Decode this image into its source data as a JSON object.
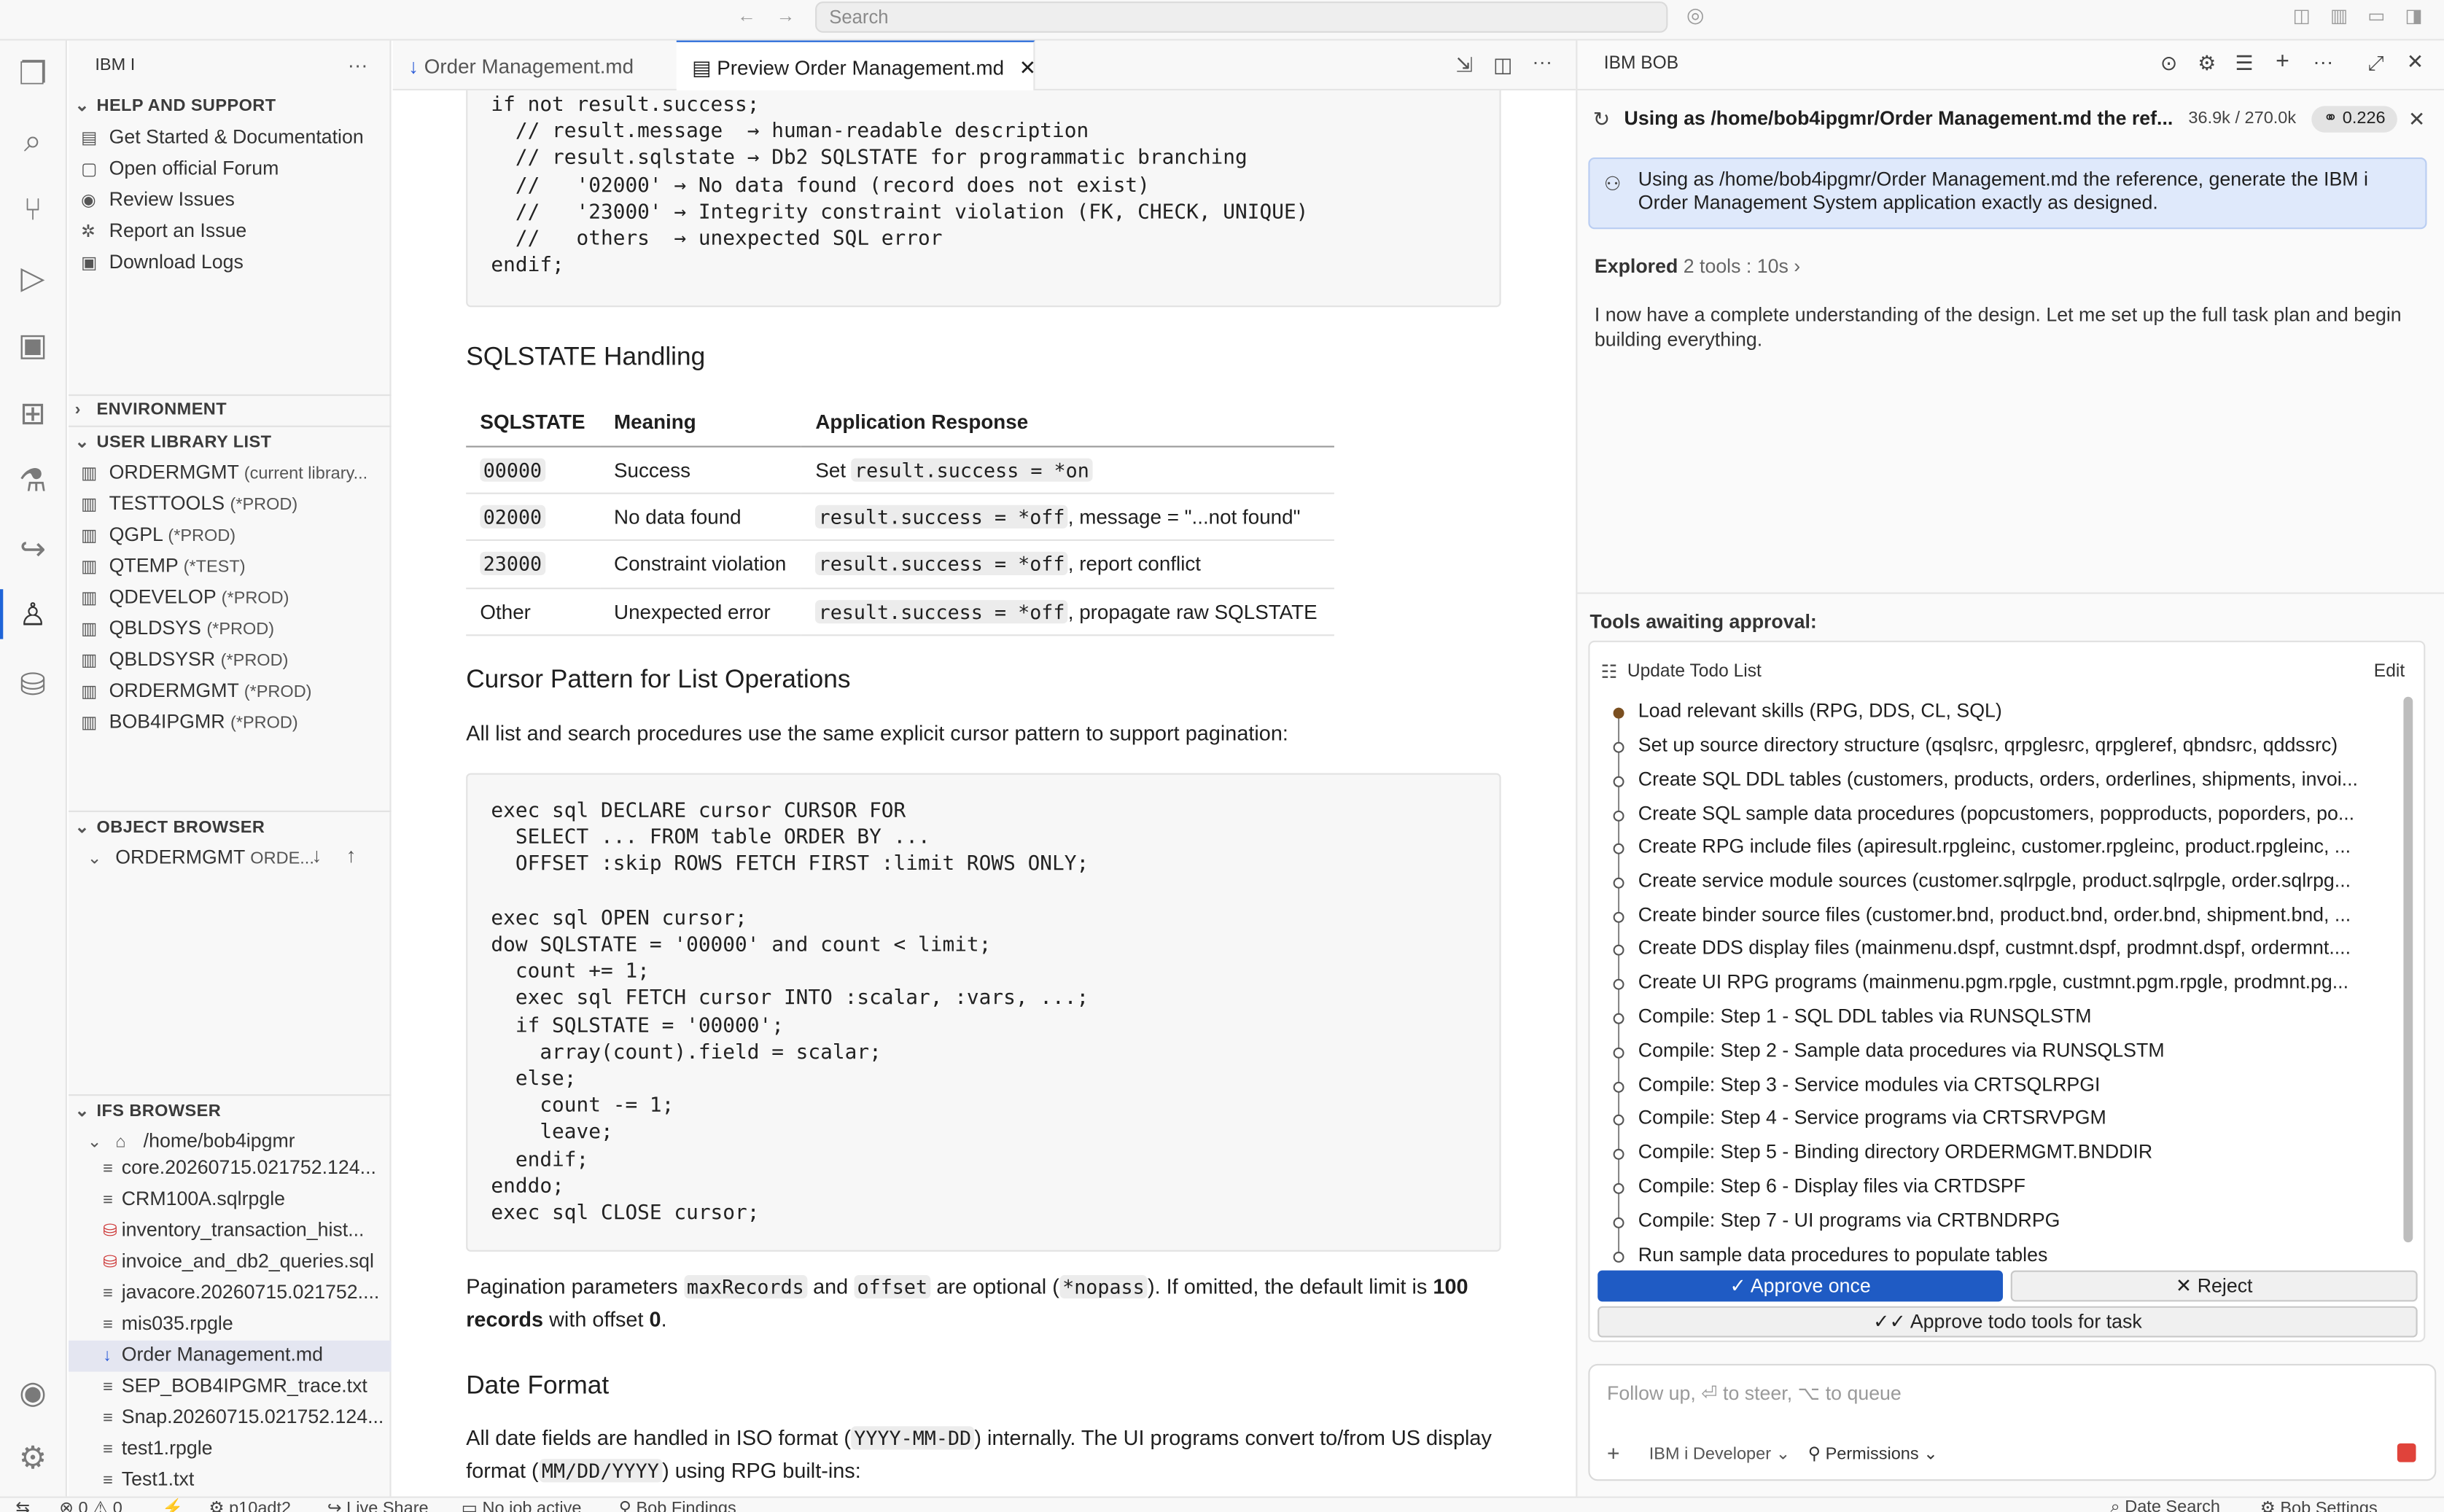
{
  "titlebar": {
    "search_placeholder": "Search"
  },
  "sidebar": {
    "title": "IBM I",
    "help_section": {
      "title": "HELP AND SUPPORT",
      "items": [
        "Get Started & Documentation",
        "Open official Forum",
        "Review Issues",
        "Report an Issue",
        "Download Logs"
      ]
    },
    "environment_title": "ENVIRONMENT",
    "library_title": "USER LIBRARY LIST",
    "libraries": [
      {
        "name": "ORDERMGMT",
        "tag": "(current library..."
      },
      {
        "name": "TESTTOOLS",
        "tag": "(*PROD)"
      },
      {
        "name": "QGPL",
        "tag": "(*PROD)"
      },
      {
        "name": "QTEMP",
        "tag": "(*TEST)"
      },
      {
        "name": "QDEVELOP",
        "tag": "(*PROD)"
      },
      {
        "name": "QBLDSYS",
        "tag": "(*PROD)"
      },
      {
        "name": "QBLDSYSR",
        "tag": "(*PROD)"
      },
      {
        "name": "ORDERMGMT",
        "tag": "(*PROD)"
      },
      {
        "name": "BOB4IPGMR",
        "tag": "(*PROD)"
      }
    ],
    "object_browser_title": "OBJECT BROWSER",
    "object_filter": {
      "name": "ORDERMGMT",
      "tag": "ORDE..."
    },
    "ifs_title": "IFS BROWSER",
    "ifs_root": "/home/bob4ipgmr",
    "ifs_files": [
      "core.20260715.021752.124...",
      "CRM100A.sqlrpgle",
      "inventory_transaction_hist...",
      "invoice_and_db2_queries.sql",
      "javacore.20260715.021752....",
      "mis035.rpgle",
      "Order Management.md",
      "SEP_BOB4IPGMR_trace.txt",
      "Snap.20260715.021752.124...",
      "test1.rpgle",
      "Test1.txt"
    ]
  },
  "editor": {
    "tabs": [
      "Order Management.md",
      "Preview Order Management.md"
    ],
    "code1": "if not result.success;\n  // result.message  → human-readable description\n  // result.sqlstate → Db2 SQLSTATE for programmatic branching\n  //   '02000' → No data found (record does not exist)\n  //   '23000' → Integrity constraint violation (FK, CHECK, UNIQUE)\n  //   others  → unexpected SQL error\nendif;",
    "sqlstate_heading": "SQLSTATE Handling",
    "table_headers": [
      "SQLSTATE",
      "Meaning",
      "Application Response"
    ],
    "table_rows": [
      {
        "code": "00000",
        "meaning": "Success",
        "pre": "Set ",
        "resp_code": "result.success = *on",
        "resp_text": ""
      },
      {
        "code": "02000",
        "meaning": "No data found",
        "pre": "",
        "resp_code": "result.success = *off",
        "resp_text": ", message = \"...not found\""
      },
      {
        "code": "23000",
        "meaning": "Constraint violation",
        "pre": "",
        "resp_code": "result.success = *off",
        "resp_text": ", report conflict"
      },
      {
        "code": "Other",
        "meaning": "Unexpected error",
        "pre": "",
        "resp_code": "result.success = *off",
        "resp_text": ", propagate raw SQLSTATE"
      }
    ],
    "cursor_heading": "Cursor Pattern for List Operations",
    "cursor_intro": "All list and search procedures use the same explicit cursor pattern to support pagination:",
    "code2": "exec sql DECLARE cursor CURSOR FOR\n  SELECT ... FROM table ORDER BY ...\n  OFFSET :skip ROWS FETCH FIRST :limit ROWS ONLY;\n\nexec sql OPEN cursor;\ndow SQLSTATE = '00000' and count < limit;\n  count += 1;\n  exec sql FETCH cursor INTO :scalar, :vars, ...;\n  if SQLSTATE = '00000';\n    array(count).field = scalar;\n  else;\n    count -= 1;\n    leave;\n  endif;\nenddo;\nexec sql CLOSE cursor;",
    "pagination": {
      "t1": "Pagination parameters ",
      "c1": "maxRecords",
      "t2": " and ",
      "c2": "offset",
      "t3": " are optional (",
      "c3": "*nopass",
      "t4": "). If omitted, the default limit is ",
      "b1": "100",
      "line2_b": "records",
      "line2_t": " with offset ",
      "line2_b2": "0",
      "line2_end": "."
    },
    "date_heading": "Date Format",
    "date_para": {
      "t1": "All date fields are handled in ISO format (",
      "c1": "YYYY-MM-DD",
      "t2": ") internally. The UI programs convert to/from US display",
      "t3": "format (",
      "c2": "MM/DD/YYYY",
      "t4": ") using RPG built-ins:"
    }
  },
  "panel": {
    "tab": "IBM BOB",
    "task_title": "Using as /home/bob4ipgmr/Order Management.md the ref...",
    "tokens": "36.9k / 270.0k",
    "cost": "0.226",
    "prompt": "Using as /home/bob4ipgmr/Order Management.md the reference, generate the IBM i  Order Management System application exactly as designed.",
    "explored_label": "Explored",
    "explored_detail": "2 tools : 10s",
    "message": "I now have a complete understanding of the design. Let me set up the full task plan and begin building everything.",
    "approval_title": "Tools awaiting approval:",
    "todo_title": "Update Todo List",
    "edit_label": "Edit",
    "todos": [
      "Load relevant skills (RPG, DDS, CL, SQL)",
      "Set up source directory structure (qsqlsrc, qrpglesrc, qrpgleref, qbndsrc, qddssrc)",
      "Create SQL DDL tables (customers, products, orders, orderlines, shipments, invoi...",
      "Create SQL sample data procedures (popcustomers, popproducts, poporders, po...",
      "Create RPG include files (apiresult.rpgleinc, customer.rpgleinc, product.rpgleinc, ...",
      "Create service module sources (customer.sqlrpgle, product.sqlrpgle, order.sqlrpg...",
      "Create binder source files (customer.bnd, product.bnd, order.bnd, shipment.bnd, ...",
      "Create DDS display files (mainmenu.dspf, custmnt.dspf, prodmnt.dspf, ordermnt....",
      "Create UI RPG programs (mainmenu.pgm.rpgle, custmnt.pgm.rpgle, prodmnt.pg...",
      "Compile: Step 1 - SQL DDL tables via RUNSQLSTM",
      "Compile: Step 2 - Sample data procedures via RUNSQLSTM",
      "Compile: Step 3 - Service modules via CRTSQLRPGI",
      "Compile: Step 4 - Service programs via CRTSRVPGM",
      "Compile: Step 5 - Binding directory ORDERMGMT.BNDDIR",
      "Compile: Step 6 - Display files via CRTDSPF",
      "Compile: Step 7 - UI programs via CRTBNDRPG",
      "Run sample data procedures to populate tables"
    ],
    "approve_label": "Approve once",
    "reject_label": "Reject",
    "approve_task_label": "Approve todo tools for task",
    "input_placeholder": "Follow up, ⏎ to steer, ⌥ to queue",
    "mode_label": "IBM i Developer",
    "permissions_label": "Permissions"
  },
  "statusbar": {
    "errors": "0",
    "warnings": "0",
    "connection": "p10adt2",
    "live_share": "Live Share",
    "job": "No job active",
    "findings": "Bob Findings",
    "date_search": "Date Search",
    "settings": "Bob Settings"
  },
  "colors": {
    "accent": "#1f64d8",
    "bubble": "#dfe9fb",
    "approve": "#1f5bc4"
  }
}
